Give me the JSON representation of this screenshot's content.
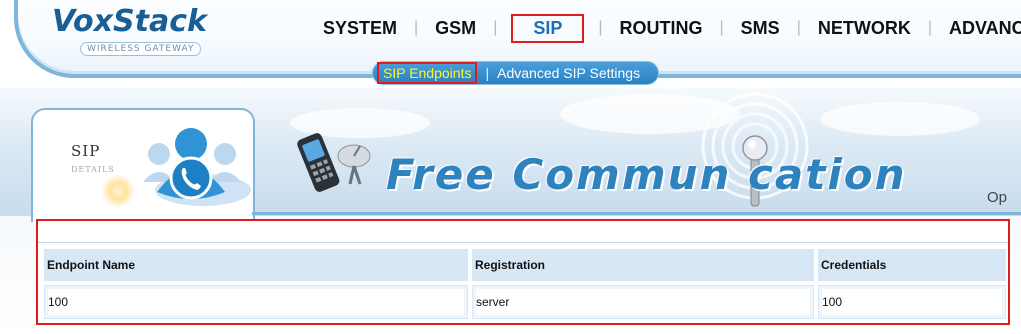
{
  "brand": {
    "name": "VoxStack",
    "tagline": "WIRELESS GATEWAY",
    "colors": {
      "primary": "#1a5e93",
      "accent": "#2a7fc2",
      "highlight_box": "#e01b1b",
      "active_sub": "#fff32b"
    }
  },
  "nav": {
    "items": [
      {
        "label": "SYSTEM",
        "active": false
      },
      {
        "label": "GSM",
        "active": false
      },
      {
        "label": "SIP",
        "active": true
      },
      {
        "label": "ROUTING",
        "active": false
      },
      {
        "label": "SMS",
        "active": false
      },
      {
        "label": "NETWORK",
        "active": false
      },
      {
        "label": "ADVANCE",
        "active": false
      }
    ]
  },
  "subnav": {
    "items": [
      {
        "label": "SIP Endpoints",
        "active": true
      },
      {
        "label": "Advanced SIP Settings",
        "active": false
      }
    ]
  },
  "banner": {
    "section_title": "SIP",
    "section_subtitle": "DETAILS",
    "slogan": "Free Commun   cation",
    "cropped_text": "Op",
    "icons": [
      "user-group-icon",
      "phone-icon",
      "mobile-phone-icon",
      "satellite-dish-icon",
      "wireless-antenna-icon"
    ]
  },
  "table": {
    "columns": [
      "Endpoint Name",
      "Registration",
      "Credentials"
    ],
    "rows": [
      [
        "100",
        "server",
        "100"
      ]
    ]
  }
}
